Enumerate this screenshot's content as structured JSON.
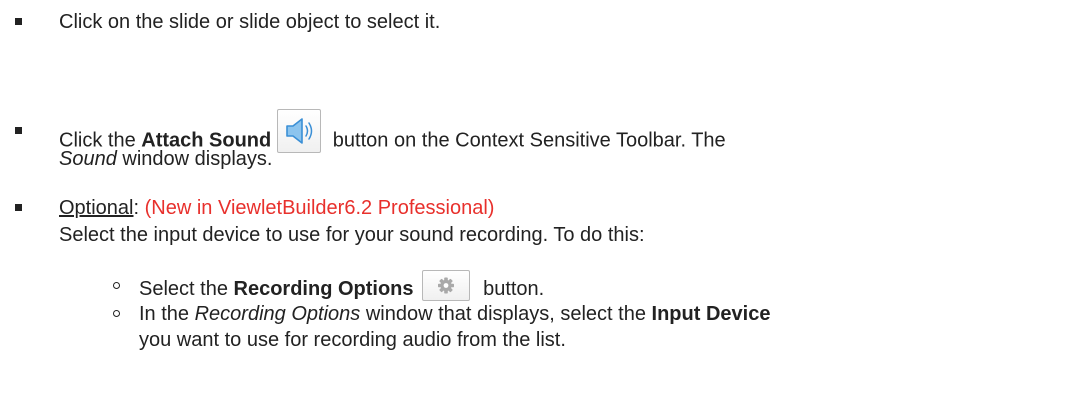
{
  "items": [
    {
      "text": "Click on the slide or slide object to select it."
    },
    {
      "pre": "Click the ",
      "bold": "Attach Sound",
      "post": " button on the Context Sensitive Toolbar. The",
      "line2_italic": "Sound",
      "line2_rest": " window displays.",
      "icon": "speaker-icon"
    },
    {
      "optional_label": "Optional",
      "colon": ":",
      "new_note": "(New in ViewletBuilder6.2 Professional)",
      "line2": "Select the input device to use for your sound recording. To do this:",
      "subitems": [
        {
          "pre": "Select the ",
          "bold": "Recording Options",
          "post": " button.",
          "icon": "gear-icon"
        },
        {
          "pre": "In the ",
          "italic": "Recording Options",
          "mid": " window that displays, select the ",
          "bold": "Input Device",
          "line2": "you want to use for recording audio from the list."
        }
      ]
    }
  ],
  "colors": {
    "text": "#222222",
    "highlight": "#e8302c",
    "icon_blue": "#3a8fd6"
  }
}
